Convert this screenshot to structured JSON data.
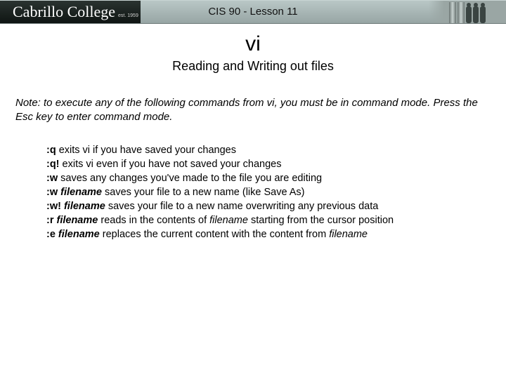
{
  "header": {
    "logo_text": "Cabrillo College",
    "logo_sub": "est. 1959",
    "title": "CIS 90 - Lesson 11"
  },
  "main": {
    "title": "vi",
    "subtitle": "Reading and Writing out files",
    "note": "Note: to execute any of the following commands from vi, you must be in command mode.  Press the Esc key to enter command mode.",
    "items": [
      {
        "cmd": ":q",
        "arg": "",
        "desc_before": "",
        "desc": " exits vi if you have saved your changes"
      },
      {
        "cmd": ":q!",
        "arg": "",
        "desc_before": "",
        "desc": " exits vi even if you have not saved your changes"
      },
      {
        "cmd": ":w",
        "arg": "",
        "desc_before": "",
        "desc": " saves any changes you've made to the file you are editing"
      },
      {
        "cmd": ":w ",
        "arg": "filename",
        "desc_before": "",
        "desc": " saves your file to a new name (like Save As)"
      },
      {
        "cmd": ":w! ",
        "arg": "filename",
        "desc_before": "",
        "desc": " saves your file to a new name overwriting any previous data"
      },
      {
        "cmd": ":r ",
        "arg": "filename",
        "desc_before": "",
        "desc_a": " reads in the contents of ",
        "arg2": "filename",
        "desc_b": " starting from the cursor position"
      },
      {
        "cmd": ":e ",
        "arg": "filename",
        "desc_before": "",
        "desc_a": " replaces the current content with the content from ",
        "arg2": "filename",
        "desc_b": ""
      }
    ]
  }
}
